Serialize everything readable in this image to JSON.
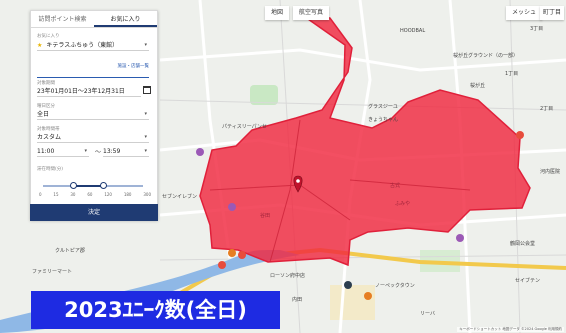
{
  "map_buttons": {
    "map": "地図",
    "satellite": "航空写真",
    "message": "メッシュ",
    "town": "町丁目"
  },
  "panel": {
    "tab_search": "訪問ポイント検索",
    "tab_favorite": "お気に入り",
    "favorite_label": "お気に入り",
    "favorite_value": "キテラスふちゅう（東館）",
    "facility_link": "施設・店舗一覧",
    "period_label": "対象期間",
    "period_value": "23年01月01日～23年12月31日",
    "day_label": "曜日区分",
    "day_value": "全日",
    "time_label": "対象時間帯",
    "time_value": "カスタム",
    "time_from": "11:00",
    "time_to": "13:59",
    "tilde": "～",
    "stay_label": "滞在時間(分)",
    "stay_ticks": [
      "0",
      "15",
      "30",
      "60",
      "120",
      "180",
      "300"
    ],
    "stay_range": [
      60,
      120
    ],
    "decide": "決定"
  },
  "caption": "2023ﾕﾆｰｸ数(全日)",
  "map_labels": {
    "hoodbal": "HOODBAL",
    "ground": "桜が丘グラウンド（の一部）",
    "sakura": "桜が丘",
    "itchome": "1丁目",
    "nichome": "2丁目",
    "sanchome": "3丁目",
    "kawaguchi": "河内医院",
    "patissier": "パティスリーパンセ",
    "glass": "グラスジーユ",
    "kyo": "きょうちゃん",
    "fumiya": "ふみや",
    "tani": "谷田",
    "koshiki": "古式",
    "seven": "セブンイレブン",
    "culture": "クルトピア郡",
    "family": "ファミリーマート",
    "lawson": "ローソン府中店",
    "yaoko": "ノーペックタウン",
    "koen": "鶴岡公会堂",
    "seven2": "セイブテン",
    "senior": "リーバ",
    "uchida": "内田",
    "attribution": "キーボードショートカット 地図データ ©2024 Google 利用規約"
  },
  "colors": {
    "area_fill": "#f0283f",
    "area_stroke": "#e0203a",
    "caption_bg": "#1e2be2",
    "button_blue": "#1f3b73"
  }
}
